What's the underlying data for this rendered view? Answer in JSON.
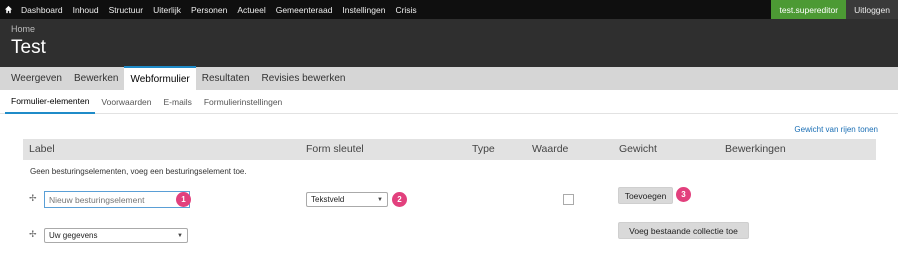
{
  "topbar": {
    "home_icon": "home-icon",
    "menu": [
      "Dashboard",
      "Inhoud",
      "Structuur",
      "Uiterlijk",
      "Personen",
      "Actueel",
      "Gemeenteraad",
      "Instellingen",
      "Crisis"
    ],
    "user": "test.supereditor",
    "logout": "Uitloggen",
    "user_color": "#4c9a34"
  },
  "header": {
    "breadcrumb": "Home",
    "title": "Test"
  },
  "primary_tabs": [
    "Weergeven",
    "Bewerken",
    "Webformulier",
    "Resultaten",
    "Revisies bewerken"
  ],
  "primary_active": "Webformulier",
  "secondary_tabs": [
    "Formulier-elementen",
    "Voorwaarden",
    "E-mails",
    "Formulierinstellingen"
  ],
  "secondary_active": "Formulier-elementen",
  "weights_link": "Gewicht van rijen tonen",
  "table": {
    "columns": [
      "Label",
      "Form sleutel",
      "Type",
      "Waarde",
      "Gewicht",
      "Bewerkingen"
    ],
    "empty_message": "Geen besturingselementen, voeg een besturingselement toe."
  },
  "row1": {
    "drag_icon": "drag-handle-icon",
    "label_placeholder": "Nieuw besturingselement",
    "type_select": "Tekstveld",
    "add_button": "Toevoegen"
  },
  "row2": {
    "drag_icon": "drag-handle-icon",
    "collection_select": "Uw gegevens",
    "add_collection_button": "Voeg bestaande collectie toe"
  },
  "badges": [
    "1",
    "2",
    "3"
  ],
  "badge_color": "#e2407d",
  "accent": "#1f8bc8"
}
